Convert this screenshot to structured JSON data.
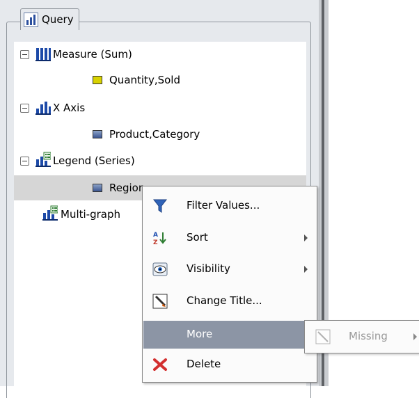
{
  "panel": {
    "title": "Query"
  },
  "tree": {
    "measure": {
      "label": "Measure (Sum)",
      "child": "Quantity,Sold"
    },
    "xaxis": {
      "label": "X Axis",
      "child": "Product,Category"
    },
    "legend": {
      "label": "Legend (Series)",
      "child": "Region"
    },
    "multigraph": {
      "label": "Multi-graph"
    }
  },
  "context_menu": {
    "items": [
      {
        "label": "Filter Values...",
        "icon": "filter-icon"
      },
      {
        "label": "Sort",
        "icon": "sort-icon",
        "submenu": true
      },
      {
        "label": "Visibility",
        "icon": "eye-icon",
        "submenu": true
      },
      {
        "label": "Change Title...",
        "icon": "rename-icon"
      },
      {
        "label": "More",
        "icon": "",
        "submenu": true,
        "active": true
      },
      {
        "label": "Delete",
        "icon": "delete-icon"
      }
    ]
  },
  "submenu": {
    "items": [
      {
        "label": "Missing",
        "icon": "missing-icon",
        "disabled": true
      }
    ]
  },
  "colors": {
    "highlight": "#8c95a5",
    "selected_row": "#d6d6d6",
    "panel_bg": "#e6e9ed"
  }
}
